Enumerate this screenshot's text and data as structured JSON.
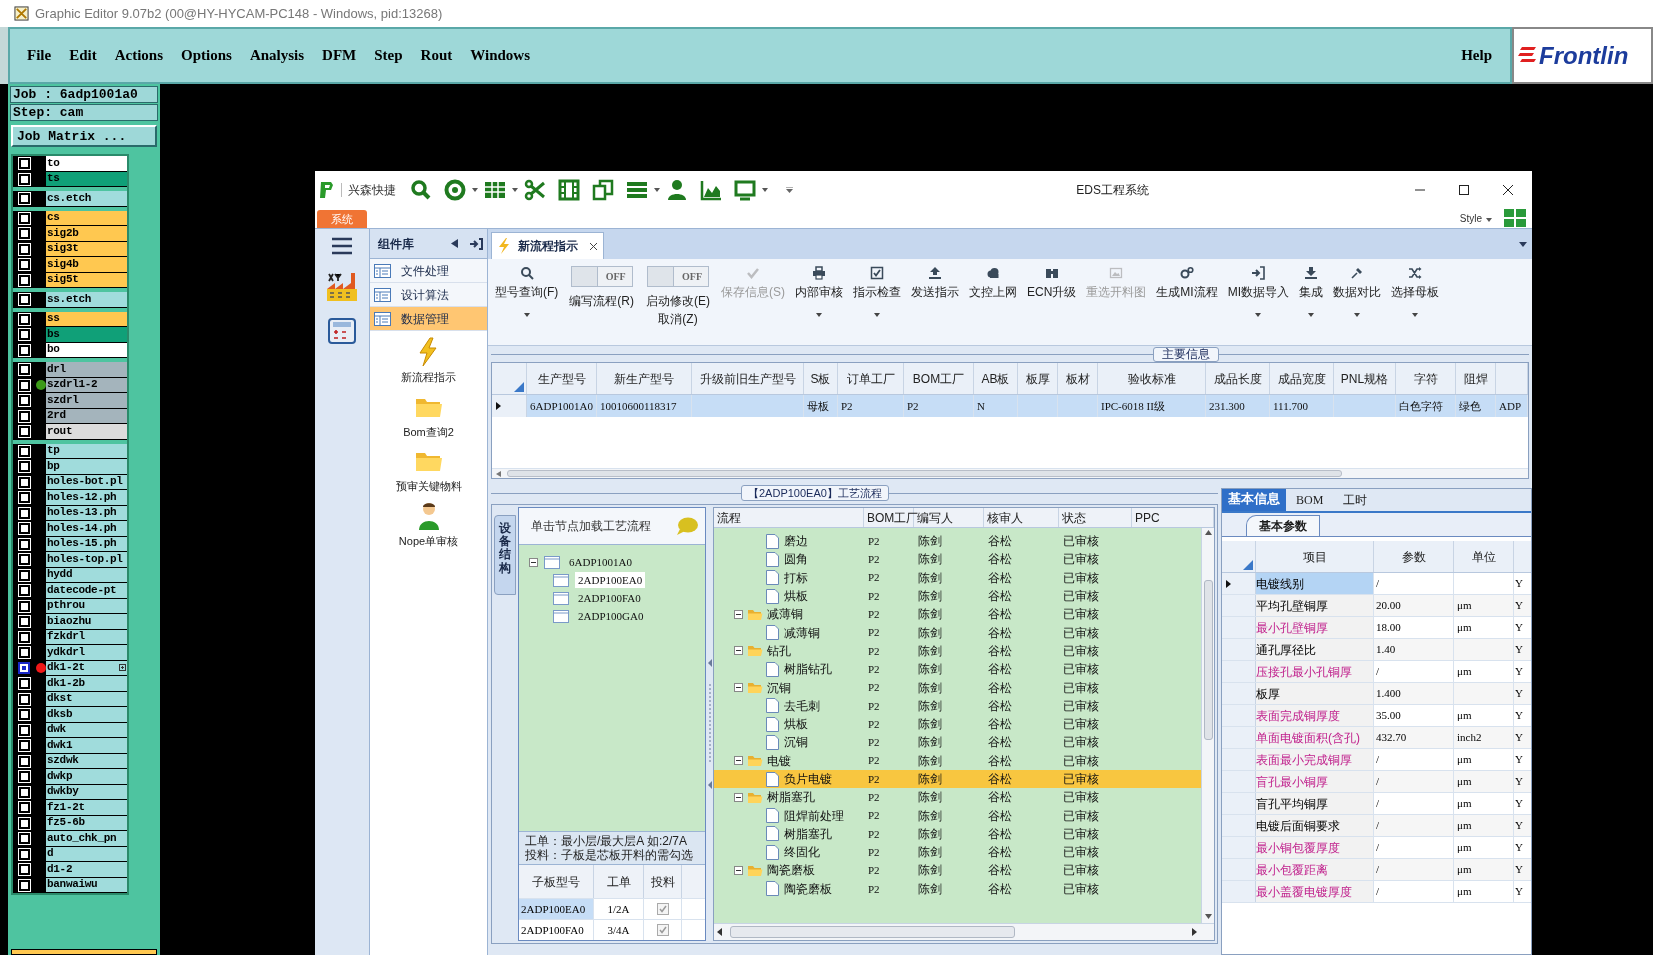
{
  "window": {
    "title": "Graphic Editor 9.07b2 (00@HY-HYCAM-PC148 - Windows, pid:13268)"
  },
  "menu": [
    "File",
    "Edit",
    "Actions",
    "Options",
    "Analysis",
    "DFM",
    "Step",
    "Rout",
    "Windows"
  ],
  "help": "Help",
  "logo": "Frontlin",
  "job": {
    "job": "Job : 6adp1001a0",
    "step": "Step: cam",
    "matrix_button": "Job Matrix ..."
  },
  "layer_groups": [
    [
      {
        "name": "to",
        "color": "#ffffff",
        "selected": false
      },
      {
        "name": "ts",
        "color": "#10a078",
        "selected": false
      }
    ],
    [
      {
        "name": "cs.etch",
        "color": "#a0dcdc",
        "selected": false
      }
    ],
    [
      {
        "name": "cs",
        "color": "#ffc850",
        "selected": false
      },
      {
        "name": "sig2b",
        "color": "#ffc850",
        "selected": false
      },
      {
        "name": "sig3t",
        "color": "#ffc850",
        "selected": false
      },
      {
        "name": "sig4b",
        "color": "#ffc850",
        "selected": false
      },
      {
        "name": "sig5t",
        "color": "#ffc850",
        "selected": false
      }
    ],
    [
      {
        "name": "ss.etch",
        "color": "#a0dcdc",
        "selected": false
      }
    ],
    [
      {
        "name": "ss",
        "color": "#ffc850",
        "selected": false
      },
      {
        "name": "bs",
        "color": "#10a078",
        "selected": false
      },
      {
        "name": "bo",
        "color": "#ffffff",
        "selected": false
      }
    ],
    [
      {
        "name": "drl",
        "color": "#a4b4bc",
        "selected": false
      },
      {
        "name": "szdrl1-2",
        "color": "#a4b4bc",
        "marker": {
          "color": "#3c9a18"
        },
        "selected": false
      },
      {
        "name": "szdrl",
        "color": "#a4b4bc",
        "selected": false
      },
      {
        "name": "2rd",
        "color": "#a4b4bc",
        "selected": false
      },
      {
        "name": "rout",
        "color": "#dcdcdc",
        "selected": false
      }
    ],
    [
      {
        "name": "tp",
        "color": "#a0dcdc",
        "selected": false
      },
      {
        "name": "bp",
        "color": "#a0dcdc",
        "selected": false
      },
      {
        "name": "holes-bot.pl",
        "color": "#a0dcdc",
        "selected": false
      },
      {
        "name": "holes-12.ph",
        "color": "#a0dcdc",
        "selected": false
      },
      {
        "name": "holes-13.ph",
        "color": "#a0dcdc",
        "selected": false
      },
      {
        "name": "holes-14.ph",
        "color": "#a0dcdc",
        "selected": false
      },
      {
        "name": "holes-15.ph",
        "color": "#a0dcdc",
        "selected": false
      },
      {
        "name": "holes-top.pl",
        "color": "#a0dcdc",
        "selected": false
      },
      {
        "name": "hydd",
        "color": "#a0dcdc",
        "selected": false
      },
      {
        "name": "datecode-pt",
        "color": "#a0dcdc",
        "selected": false
      },
      {
        "name": "pthrou",
        "color": "#a0dcdc",
        "selected": false
      },
      {
        "name": "biaozhu",
        "color": "#a0dcdc",
        "selected": false
      },
      {
        "name": "fzkdrl",
        "color": "#a0dcdc",
        "selected": false
      },
      {
        "name": "ydkdrl",
        "color": "#a0dcdc",
        "selected": false
      },
      {
        "name": "dk1-2t",
        "color": "#a0dcdc",
        "marker": {
          "color": "#f01818"
        },
        "selected": true
      },
      {
        "name": "dk1-2b",
        "color": "#a0dcdc",
        "selected": false
      },
      {
        "name": "dkst",
        "color": "#a0dcdc",
        "selected": false
      },
      {
        "name": "dksb",
        "color": "#a0dcdc",
        "selected": false
      },
      {
        "name": "dwk",
        "color": "#a0dcdc",
        "selected": false
      },
      {
        "name": "dwk1",
        "color": "#a0dcdc",
        "selected": false
      },
      {
        "name": "szdwk",
        "color": "#a0dcdc",
        "selected": false
      },
      {
        "name": "dwkp",
        "color": "#a0dcdc",
        "selected": false
      },
      {
        "name": "dwkby",
        "color": "#a0dcdc",
        "selected": false
      },
      {
        "name": "fz1-2t",
        "color": "#a0dcdc",
        "selected": false
      },
      {
        "name": "fz5-6b",
        "color": "#a0dcdc",
        "selected": false
      },
      {
        "name": "auto_chk_pn",
        "color": "#a0dcdc",
        "selected": false
      },
      {
        "name": "d",
        "color": "#a0dcdc",
        "selected": false
      },
      {
        "name": "d1-2",
        "color": "#a0dcdc",
        "selected": false
      },
      {
        "name": "banwaiwu",
        "color": "#a0dcdc",
        "selected": false
      }
    ]
  ],
  "eds": {
    "brand": "兴森快捷",
    "title": "EDS工程系统",
    "system_tab": "系统",
    "style_label": "Style",
    "nav_header": "组件库",
    "nav_items": [
      {
        "label": "文件处理",
        "selected": false
      },
      {
        "label": "设计算法",
        "selected": false
      },
      {
        "label": "数据管理",
        "selected": true
      }
    ],
    "launchers": [
      "新流程指示",
      "Bom查询2",
      "预审关键物料",
      "Nope单审核"
    ],
    "doc_tab": "新流程指示",
    "ribbon": [
      {
        "kind": "button",
        "label": "型号查询(F)",
        "disabled": false,
        "dropdown": true
      },
      {
        "kind": "toggle",
        "state": "OFF",
        "on": false,
        "label": "编写流程(R)"
      },
      {
        "kind": "toggle",
        "state": "OFF",
        "on": false,
        "label": "启动修改(E)",
        "label2": "取消(Z)"
      },
      {
        "kind": "button",
        "label": "保存信息(S)",
        "disabled": true,
        "dropdown": false
      },
      {
        "kind": "button",
        "label": "内部审核",
        "disabled": false,
        "dropdown": true
      },
      {
        "kind": "button",
        "label": "指示检查",
        "disabled": false,
        "dropdown": true
      },
      {
        "kind": "button",
        "label": "发送指示",
        "disabled": false,
        "dropdown": false
      },
      {
        "kind": "button",
        "label": "文控上网",
        "disabled": false,
        "dropdown": false
      },
      {
        "kind": "button",
        "label": "ECN升级",
        "disabled": false,
        "dropdown": false
      },
      {
        "kind": "button",
        "label": "重选开料图",
        "disabled": true,
        "dropdown": false
      },
      {
        "kind": "button",
        "label": "生成MI流程",
        "disabled": false,
        "dropdown": false
      },
      {
        "kind": "button",
        "label": "MI数据导入",
        "disabled": false,
        "dropdown": true
      },
      {
        "kind": "button",
        "label": "集成",
        "disabled": false,
        "dropdown": true
      },
      {
        "kind": "button",
        "label": "数据对比",
        "disabled": false,
        "dropdown": true
      },
      {
        "kind": "button",
        "label": "选择母板",
        "disabled": false,
        "dropdown": true
      }
    ],
    "main_info": {
      "title": "主要信息",
      "columns": [
        "生产型号",
        "新生产型号",
        "升级前旧生产型号",
        "S板",
        "订单工厂",
        "BOM工厂",
        "AB板",
        "板厚",
        "板材",
        "验收标准",
        "成品长度",
        "成品宽度",
        "PNL规格",
        "字符",
        "阻焊"
      ],
      "rows": [
        {
          "selected": true,
          "cells": [
            "6ADP1001A0",
            "10010600118317",
            null,
            "母板",
            "P2",
            "P2",
            "N",
            null,
            null,
            "IPC-6018 II级",
            "231.300",
            "111.700",
            null,
            "白色字符",
            "绿色",
            "ADP"
          ]
        }
      ]
    },
    "process": {
      "title": "【2ADP100EA0】工艺流程",
      "side_tab": "设备结构",
      "hint": "单击节点加载工艺流程",
      "tree": {
        "label": "6ADP1001A0",
        "expanded": true,
        "selected": false,
        "children": [
          {
            "label": "2ADP100EA0",
            "selected": true
          },
          {
            "label": "2ADP100FA0",
            "selected": false
          },
          {
            "label": "2ADP100GA0",
            "selected": false
          }
        ]
      },
      "notes": [
        "工单：最小层/最大层A 如:2/7A",
        "投料：子板是芯板开料的需勾选"
      ],
      "sub_columns": [
        "子板型号",
        "工单",
        "投料"
      ],
      "sub_rows": [
        {
          "model": "2ADP100EA0",
          "order": "1/2A",
          "checked": true,
          "selected": true
        },
        {
          "model": "2ADP100FA0",
          "order": "3/4A",
          "checked": true,
          "selected": false
        }
      ],
      "flow_columns": [
        "流程",
        "BOM工厂",
        "编写人",
        "核审人",
        "状态",
        "PPC"
      ],
      "flow": [
        {
          "kind": "continued",
          "children": [
            {
              "kind": "step",
              "label": "磨边",
              "bom": "P2",
              "writer": "陈剑",
              "reviewer": "谷松",
              "status": "已审核",
              "selected": false
            },
            {
              "kind": "step",
              "label": "圆角",
              "bom": "P2",
              "writer": "陈剑",
              "reviewer": "谷松",
              "status": "已审核",
              "selected": false
            },
            {
              "kind": "step",
              "label": "打标",
              "bom": "P2",
              "writer": "陈剑",
              "reviewer": "谷松",
              "status": "已审核",
              "selected": false
            },
            {
              "kind": "step",
              "label": "烘板",
              "bom": "P2",
              "writer": "陈剑",
              "reviewer": "谷松",
              "status": "已审核",
              "selected": false
            }
          ]
        },
        {
          "kind": "folder",
          "label": "减薄铜",
          "expanded": true,
          "bom": "P2",
          "writer": "陈剑",
          "reviewer": "谷松",
          "status": "已审核",
          "selected": false,
          "children": [
            {
              "kind": "step",
              "label": "减薄铜",
              "bom": "P2",
              "writer": "陈剑",
              "reviewer": "谷松",
              "status": "已审核",
              "selected": false
            }
          ]
        },
        {
          "kind": "folder",
          "label": "钻孔",
          "expanded": true,
          "bom": "P2",
          "writer": "陈剑",
          "reviewer": "谷松",
          "status": "已审核",
          "selected": false,
          "children": [
            {
              "kind": "step",
              "label": "树脂钻孔",
              "bom": "P2",
              "writer": "陈剑",
              "reviewer": "谷松",
              "status": "已审核",
              "selected": false
            }
          ]
        },
        {
          "kind": "folder",
          "label": "沉铜",
          "expanded": true,
          "bom": "P2",
          "writer": "陈剑",
          "reviewer": "谷松",
          "status": "已审核",
          "selected": false,
          "children": [
            {
              "kind": "step",
              "label": "去毛刺",
              "bom": "P2",
              "writer": "陈剑",
              "reviewer": "谷松",
              "status": "已审核",
              "selected": false
            },
            {
              "kind": "step",
              "label": "烘板",
              "bom": "P2",
              "writer": "陈剑",
              "reviewer": "谷松",
              "status": "已审核",
              "selected": false
            },
            {
              "kind": "step",
              "label": "沉铜",
              "bom": "P2",
              "writer": "陈剑",
              "reviewer": "谷松",
              "status": "已审核",
              "selected": false
            }
          ]
        },
        {
          "kind": "folder",
          "label": "电镀",
          "expanded": true,
          "bom": "P2",
          "writer": "陈剑",
          "reviewer": "谷松",
          "status": "已审核",
          "selected": false,
          "children": [
            {
              "kind": "step",
              "label": "负片电镀",
              "bom": "P2",
              "writer": "陈剑",
              "reviewer": "谷松",
              "status": "已审核",
              "selected": true
            }
          ]
        },
        {
          "kind": "folder",
          "label": "树脂塞孔",
          "expanded": true,
          "bom": "P2",
          "writer": "陈剑",
          "reviewer": "谷松",
          "status": "已审核",
          "selected": false,
          "children": [
            {
              "kind": "step",
              "label": "阻焊前处理",
              "bom": "P2",
              "writer": "陈剑",
              "reviewer": "谷松",
              "status": "已审核",
              "selected": false
            },
            {
              "kind": "step",
              "label": "树脂塞孔",
              "bom": "P2",
              "writer": "陈剑",
              "reviewer": "谷松",
              "status": "已审核",
              "selected": false
            },
            {
              "kind": "step",
              "label": "终固化",
              "bom": "P2",
              "writer": "陈剑",
              "reviewer": "谷松",
              "status": "已审核",
              "selected": false
            }
          ]
        },
        {
          "kind": "folder",
          "label": "陶瓷磨板",
          "expanded": true,
          "bom": "P2",
          "writer": "陈剑",
          "reviewer": "谷松",
          "status": "已审核",
          "selected": false,
          "children": [
            {
              "kind": "step",
              "label": "陶瓷磨板",
              "bom": "P2",
              "writer": "陈剑",
              "reviewer": "谷松",
              "status": "已审核",
              "selected": false
            }
          ]
        }
      ]
    },
    "params": {
      "tabs": [
        {
          "label": "基本信息",
          "selected": true
        },
        {
          "label": "BOM",
          "selected": false
        },
        {
          "label": "工时",
          "selected": false
        }
      ],
      "subtab": "基本参数",
      "columns": [
        "项目",
        "参数",
        "单位"
      ],
      "rows": [
        {
          "item": "电镀线别",
          "value": "/",
          "flag": "Y",
          "kind": "plain",
          "selected": true
        },
        {
          "item": "平均孔壁铜厚",
          "value": "20.00",
          "unit": "μm",
          "flag": "Y",
          "kind": "plain",
          "selected": false
        },
        {
          "item": "最小孔壁铜厚",
          "value": "18.00",
          "unit": "μm",
          "flag": "Y",
          "kind": "key",
          "selected": false
        },
        {
          "item": "通孔厚径比",
          "value": "1.40",
          "flag": "Y",
          "kind": "plain",
          "selected": false
        },
        {
          "item": "压接孔最小孔铜厚",
          "value": "/",
          "unit": "μm",
          "flag": "Y",
          "kind": "key",
          "selected": false
        },
        {
          "item": "板厚",
          "value": "1.400",
          "flag": "Y",
          "kind": "plain",
          "selected": false
        },
        {
          "item": "表面完成铜厚度",
          "value": "35.00",
          "unit": "μm",
          "flag": "Y",
          "kind": "key",
          "selected": false
        },
        {
          "item": "单面电镀面积(含孔)",
          "value": "432.70",
          "unit": "inch2",
          "flag": "Y",
          "kind": "key",
          "selected": false
        },
        {
          "item": "表面最小完成铜厚",
          "value": "/",
          "unit": "μm",
          "flag": "Y",
          "kind": "key",
          "selected": false
        },
        {
          "item": "盲孔最小铜厚",
          "value": "/",
          "unit": "μm",
          "flag": "Y",
          "kind": "key",
          "selected": false
        },
        {
          "item": "盲孔平均铜厚",
          "value": "/",
          "unit": "μm",
          "flag": "Y",
          "kind": "plain",
          "selected": false
        },
        {
          "item": "电镀后面铜要求",
          "value": "/",
          "unit": "μm",
          "flag": "Y",
          "kind": "plain",
          "selected": false
        },
        {
          "item": "最小铜包覆厚度",
          "value": "/",
          "unit": "μm",
          "flag": "Y",
          "kind": "key",
          "selected": false
        },
        {
          "item": "最小包覆距离",
          "value": "/",
          "unit": "μm",
          "flag": "Y",
          "kind": "key",
          "selected": false
        },
        {
          "item": "最小盖覆电镀厚度",
          "value": "/",
          "unit": "μm",
          "flag": "Y",
          "kind": "key",
          "selected": false
        }
      ]
    }
  }
}
